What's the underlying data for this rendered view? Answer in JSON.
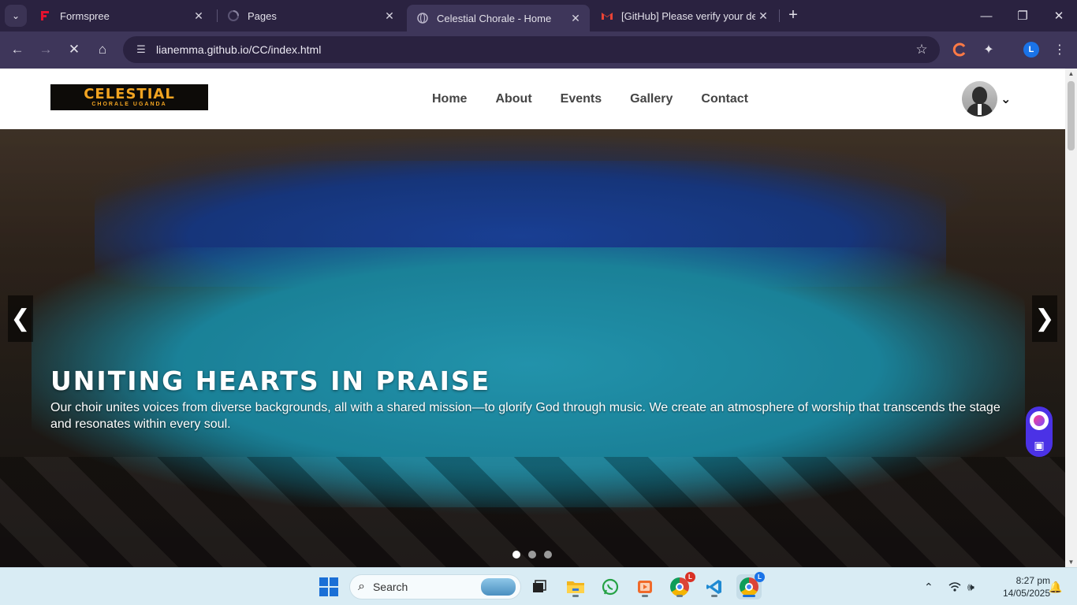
{
  "browser": {
    "tabs": [
      {
        "title": "Formspree",
        "favicon": "formspree-icon",
        "active": false
      },
      {
        "title": "Pages",
        "favicon": "loading-icon",
        "active": false
      },
      {
        "title": "Celestial Chorale - Home",
        "favicon": "globe-icon",
        "active": true
      },
      {
        "title": "[GitHub] Please verify your devi",
        "favicon": "gmail-icon",
        "active": false
      }
    ],
    "url": "lianemma.github.io/CC/index.html",
    "profile_initial": "L"
  },
  "site": {
    "logo_line1": "CELESTIAL",
    "logo_line2": "CHORALE UGANDA",
    "nav": [
      "Home",
      "About",
      "Events",
      "Gallery",
      "Contact"
    ],
    "hero": {
      "title": "UNITING HEARTS IN PRAISE",
      "text": "Our choir unites voices from diverse backgrounds, all with a shared mission—to glorify God through music. We create an atmosphere of worship that transcends the stage and resonates within every soul.",
      "prev": "❮",
      "next": "❯",
      "slides": 3,
      "active_slide": 1
    }
  },
  "taskbar": {
    "search_placeholder": "Search",
    "time": "8:27 pm",
    "date": "14/05/2025"
  },
  "colors": {
    "logo_gold": "#f2a421",
    "browser_frame": "#2a2240",
    "browser_toolbar": "#3e365a",
    "widget": "#4b32e6"
  }
}
